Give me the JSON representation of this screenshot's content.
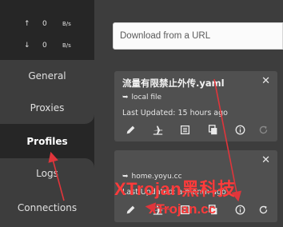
{
  "traffic": {
    "up": {
      "arrow": "↑",
      "value": "0",
      "unit": "B/s"
    },
    "down": {
      "arrow": "↓",
      "value": "0",
      "unit": "B/s"
    }
  },
  "nav": {
    "general": "General",
    "proxies": "Proxies",
    "profiles": "Profiles",
    "logs": "Logs",
    "connections": "Connections"
  },
  "url_input": {
    "placeholder": "Download from a URL"
  },
  "profiles": [
    {
      "name": "流量有限禁止外传.yaml",
      "source": "local file",
      "updated": "Last Updated: 15 hours ago",
      "close": "✕"
    },
    {
      "name": "",
      "source": "home.yoyu.cc",
      "updated": "Last Updated: a month ago",
      "close": "✕"
    }
  ],
  "source_symbol": "➥",
  "watermark": {
    "line1": "XTrojan黑科技",
    "line2": "xTrojan.cc"
  },
  "colors": {
    "sidebar_bg": "#262626",
    "main_bg": "#3d3d3d",
    "card_bg": "#505050",
    "annotation": "#e0353b"
  }
}
